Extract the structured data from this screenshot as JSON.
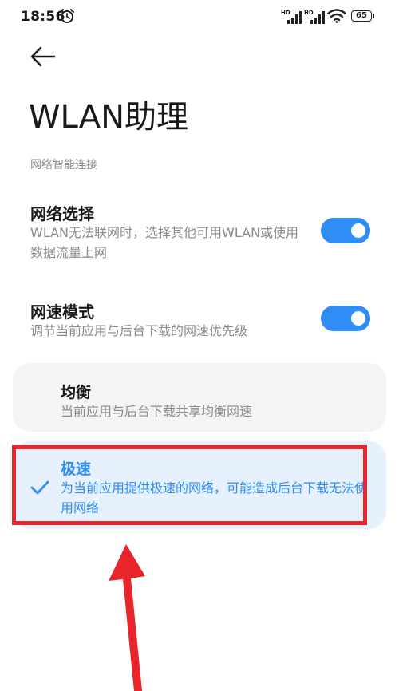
{
  "status_bar": {
    "time": "18:56",
    "hd1": "HD",
    "hd2": "HD",
    "battery": "65"
  },
  "header": {
    "title": "WLAN助理"
  },
  "section": {
    "label": "网络智能连接"
  },
  "settings": [
    {
      "title": "网络选择",
      "desc": "WLAN无法联网时，选择其他可用WLAN或使用数据流量上网",
      "enabled": true
    },
    {
      "title": "网速模式",
      "desc": "调节当前应用与后台下载的网速优先级",
      "enabled": true
    }
  ],
  "options": [
    {
      "title": "均衡",
      "desc": "当前应用与后台下载共享均衡网速",
      "selected": false
    },
    {
      "title": "极速",
      "desc": "为当前应用提供极速的网络，可能造成后台下载无法使用网络",
      "selected": true
    }
  ],
  "colors": {
    "accent": "#2f8df5",
    "highlight": "#e8252b",
    "selected_bg": "#e6f1fd",
    "card_bg": "#f4f4f4"
  }
}
